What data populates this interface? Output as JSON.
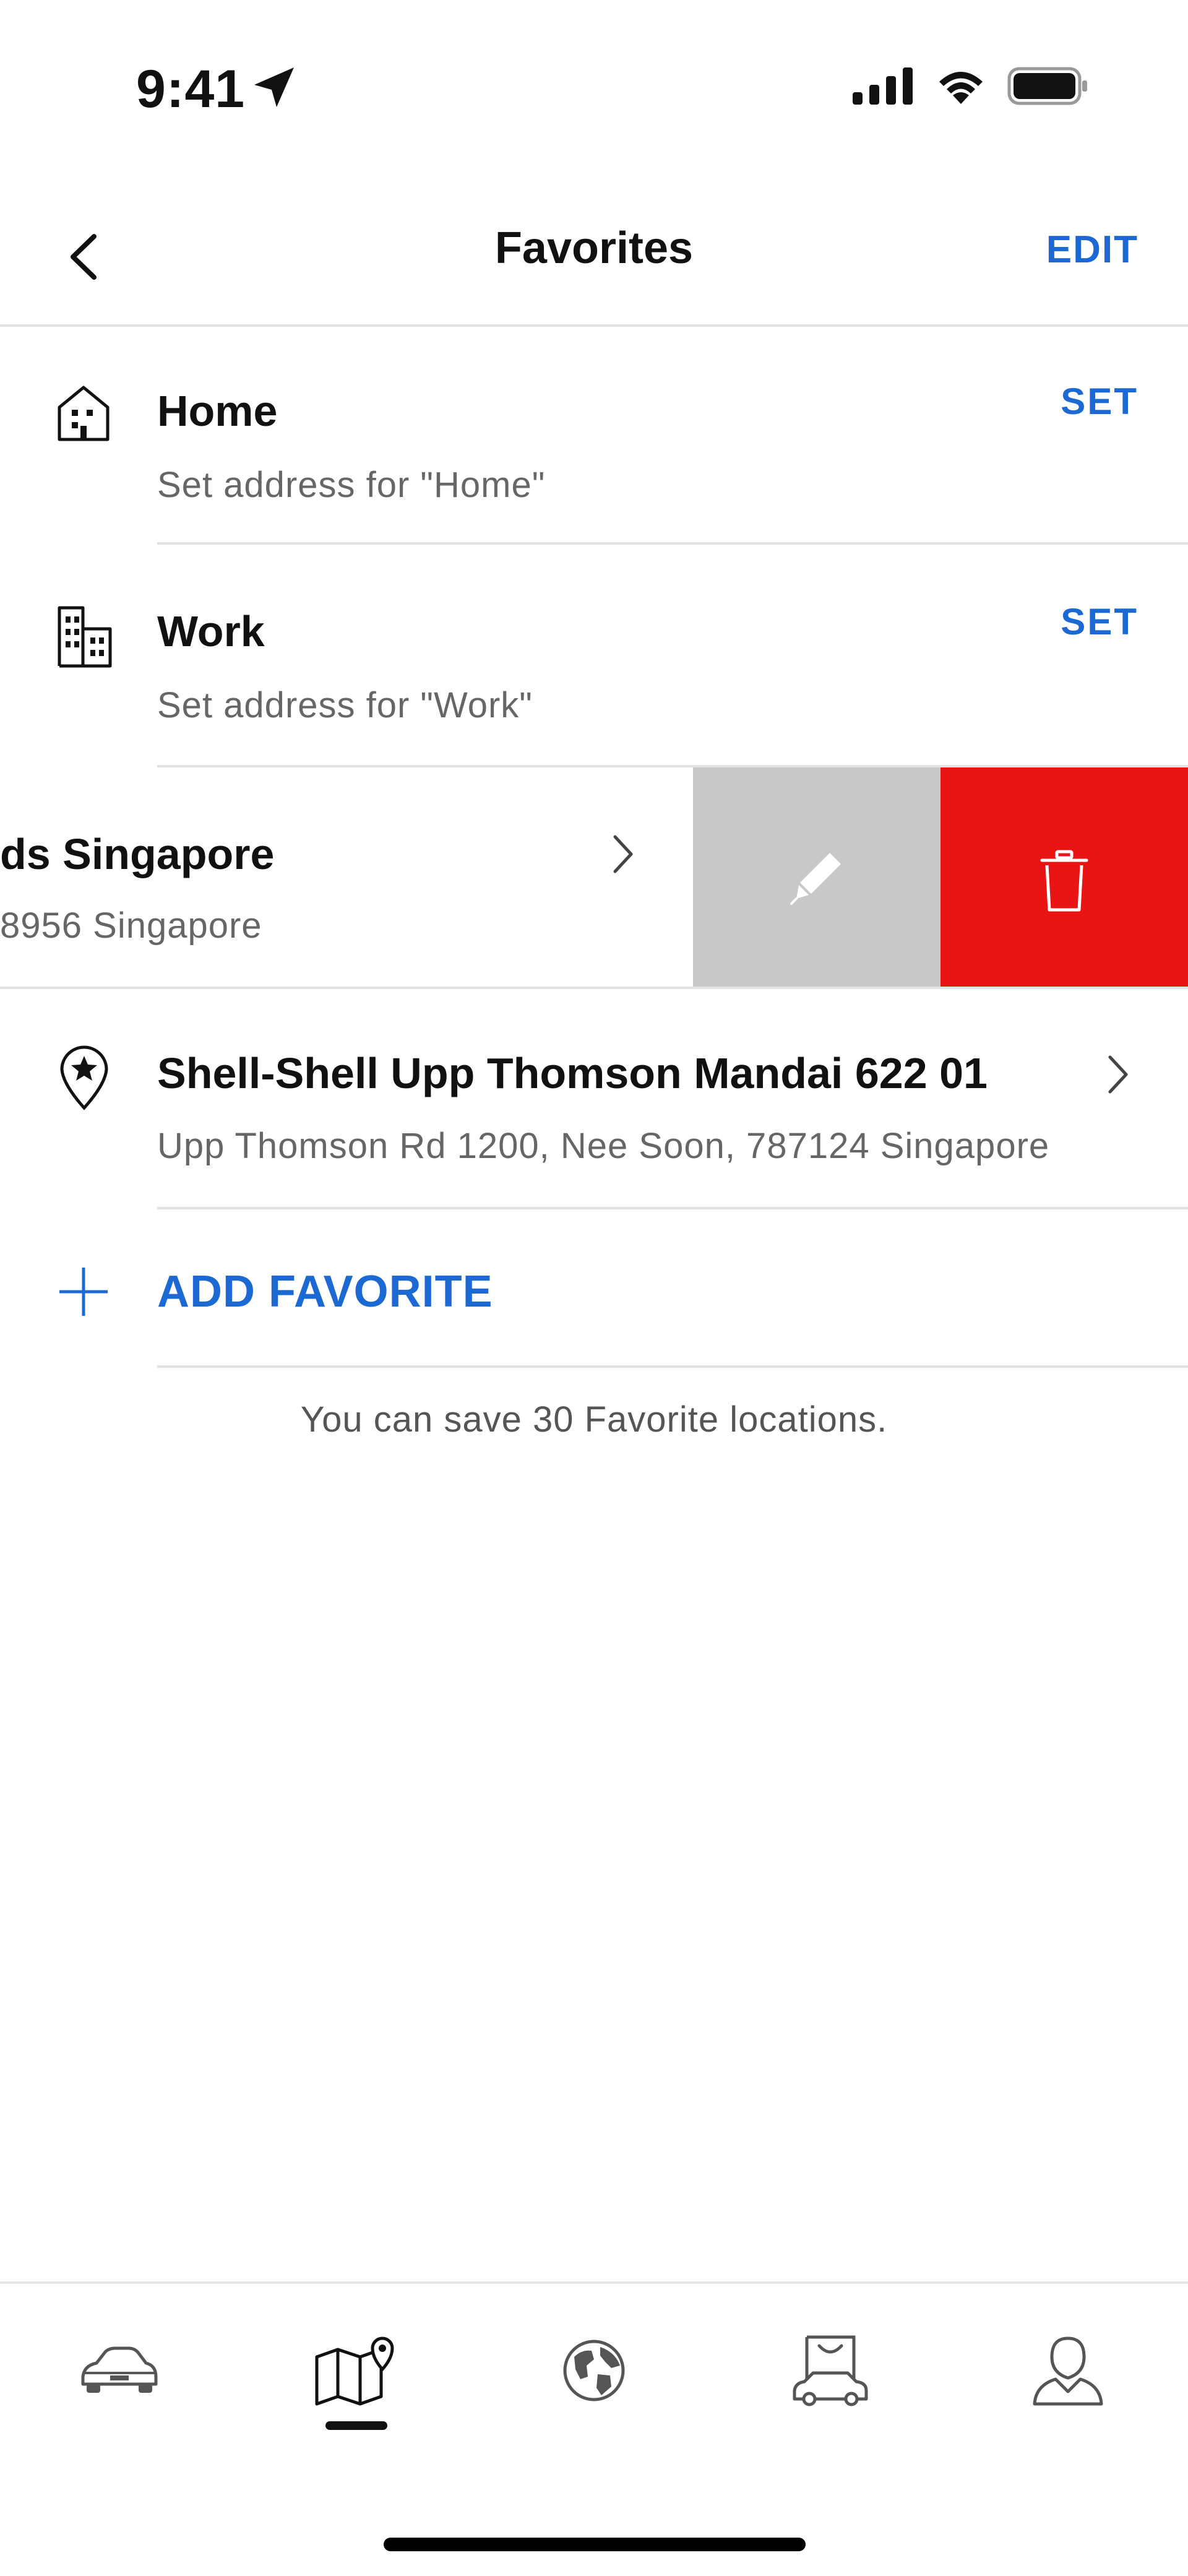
{
  "status_bar": {
    "time": "9:41"
  },
  "nav": {
    "title": "Favorites",
    "edit_label": "EDIT"
  },
  "favorites": {
    "home": {
      "title": "Home",
      "subtitle": "Set address for \"Home\"",
      "action": "SET"
    },
    "work": {
      "title": "Work",
      "subtitle": "Set address for \"Work\"",
      "action": "SET"
    },
    "swiped": {
      "title": "ds Singapore",
      "subtitle": "8956 Singapore"
    },
    "shell": {
      "title": "Shell-Shell Upp Thomson Mandai 622 01",
      "subtitle": "Upp Thomson Rd 1200, Nee Soon, 787124 Singapore"
    }
  },
  "add_favorite": {
    "label": "ADD FAVORITE"
  },
  "hint": "You can save 30 Favorite locations.",
  "colors": {
    "accent": "#1c69d4",
    "delete": "#e91414",
    "edit_bg": "#c8c8c8"
  },
  "tabbar": {
    "active_index": 1,
    "items": [
      {
        "icon": "car-icon"
      },
      {
        "icon": "map-icon"
      },
      {
        "icon": "globe-icon"
      },
      {
        "icon": "shop-icon"
      },
      {
        "icon": "profile-icon"
      }
    ]
  }
}
